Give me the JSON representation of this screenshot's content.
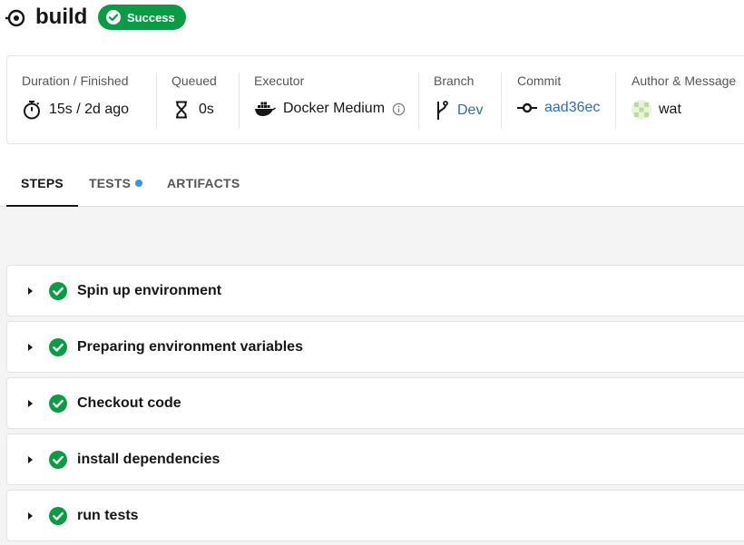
{
  "job": {
    "title": "build",
    "status": "Success",
    "status_color": "#0a9c45"
  },
  "summary": {
    "duration": {
      "label": "Duration / Finished",
      "value": "15s / 2d ago",
      "icon": "stopwatch-icon"
    },
    "queued": {
      "label": "Queued",
      "value": "0s",
      "icon": "hourglass-icon"
    },
    "executor": {
      "label": "Executor",
      "value": "Docker Medium",
      "icon": "docker-icon"
    },
    "branch": {
      "label": "Branch",
      "value": "Dev",
      "icon": "branch-icon"
    },
    "commit": {
      "label": "Commit",
      "value": "aad36ec",
      "icon": "commit-icon"
    },
    "author": {
      "label": "Author & Message",
      "value": "wat",
      "icon": "avatar"
    }
  },
  "tabs": [
    {
      "label": "STEPS",
      "active": true
    },
    {
      "label": "TESTS",
      "active": false
    },
    {
      "label": "ARTIFACTS",
      "active": false
    }
  ],
  "steps": [
    {
      "label": "Spin up environment"
    },
    {
      "label": "Preparing environment variables"
    },
    {
      "label": "Checkout code"
    },
    {
      "label": "install dependencies"
    },
    {
      "label": "run tests"
    }
  ],
  "colors": {
    "success": "#0a9c45",
    "link": "#2a6ebb",
    "tests_dot": "#3a95e0"
  }
}
